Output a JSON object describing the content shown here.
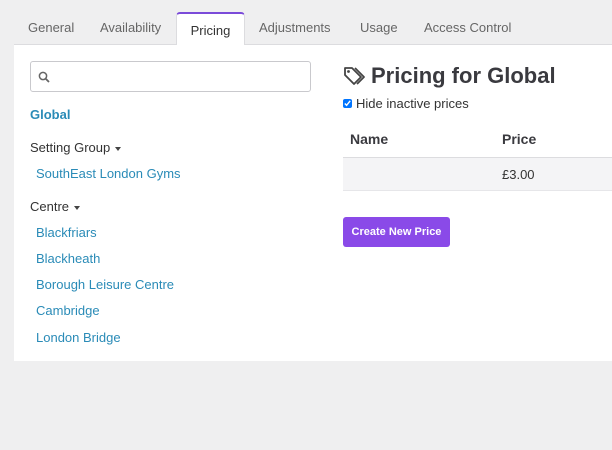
{
  "tabs": [
    "General",
    "Availability",
    "Pricing",
    "Adjustments",
    "Usage",
    "Access Control"
  ],
  "active_tab": "Pricing",
  "sidebar": {
    "search_placeholder": "",
    "global_label": "Global",
    "groups": [
      {
        "heading": "Setting Group",
        "items": [
          "SouthEast London Gyms"
        ]
      },
      {
        "heading": "Centre",
        "items": [
          "Blackfriars",
          "Blackheath",
          "Borough Leisure Centre",
          "Cambridge",
          "London Bridge"
        ]
      }
    ]
  },
  "main": {
    "title": "Pricing for Global",
    "hide_inactive_label": "Hide inactive prices",
    "hide_inactive_checked": true,
    "table": {
      "columns": [
        "Name",
        "Price"
      ],
      "rows": [
        {
          "name": "",
          "price": "£3.00"
        }
      ]
    },
    "create_button": "Create New Price"
  },
  "colors": {
    "accent": "#8a4ae8",
    "link": "#2a8bb7",
    "tab_accent": "#7b4bd9"
  }
}
